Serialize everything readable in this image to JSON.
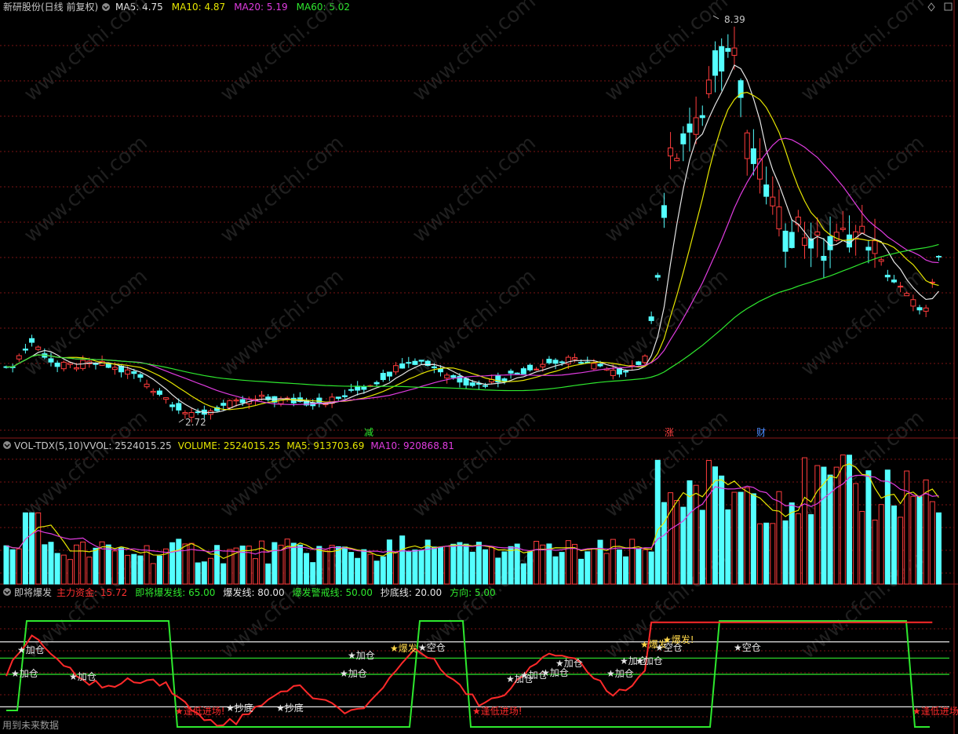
{
  "panels": {
    "main": {
      "title": "新研股份(日线 前复权)",
      "indicators": [
        {
          "label": "MA5: 4.75",
          "color": "#e6e6e6"
        },
        {
          "label": "MA10: 4.87",
          "color": "#e6e600"
        },
        {
          "label": "MA20: 5.19",
          "color": "#e03ce0"
        },
        {
          "label": "MA60: 5.02",
          "color": "#2ee82e"
        }
      ],
      "price_high_label": "8.39",
      "price_low_label": "2.72",
      "event_markers": [
        {
          "text": "减",
          "color": "#2ee82e"
        },
        {
          "text": "涨",
          "color": "#ff4040"
        },
        {
          "text": "财",
          "color": "#4a8cff"
        }
      ]
    },
    "volume": {
      "name": "VOL-TDX(5,10)",
      "indicators": [
        {
          "label": "VVOL: 2524015.25",
          "color": "#c8c8c8"
        },
        {
          "label": "VOLUME: 2524015.25",
          "color": "#e6e600"
        },
        {
          "label": "MA5: 913703.69",
          "color": "#e6e600"
        },
        {
          "label": "MA10: 920868.81",
          "color": "#e03ce0"
        }
      ]
    },
    "signal": {
      "name": "即将爆发",
      "indicators": [
        {
          "label": "主力资金: 15.72",
          "color": "#ff3030"
        },
        {
          "label": "即将爆发线: 65.00",
          "color": "#2ee82e"
        },
        {
          "label": "爆发线: 80.00",
          "color": "#e6e6e6"
        },
        {
          "label": "爆发警戒线: 50.00",
          "color": "#2ee82e"
        },
        {
          "label": "抄底线: 20.00",
          "color": "#e6e6e6"
        },
        {
          "label": "方向: 5.00",
          "color": "#2ee82e"
        }
      ],
      "signal_labels": {
        "add": "加仓",
        "empty": "空仓",
        "bottom": "抄底",
        "burst": "爆发",
        "burst_excl": "爆发!",
        "low_entry": "逢低进场!"
      },
      "footer_note": "用到未来数据"
    }
  },
  "watermark": "www.cfchi.com",
  "colors": {
    "up": "#ff3c3c",
    "down": "#54ffff",
    "grid": "#7a1414",
    "ma5": "#e6e6e6",
    "ma10": "#e6e600",
    "ma20": "#e03ce0",
    "ma60": "#2ee82e",
    "flow": "#ff2a2a",
    "direction": "#2ee82e"
  }
}
